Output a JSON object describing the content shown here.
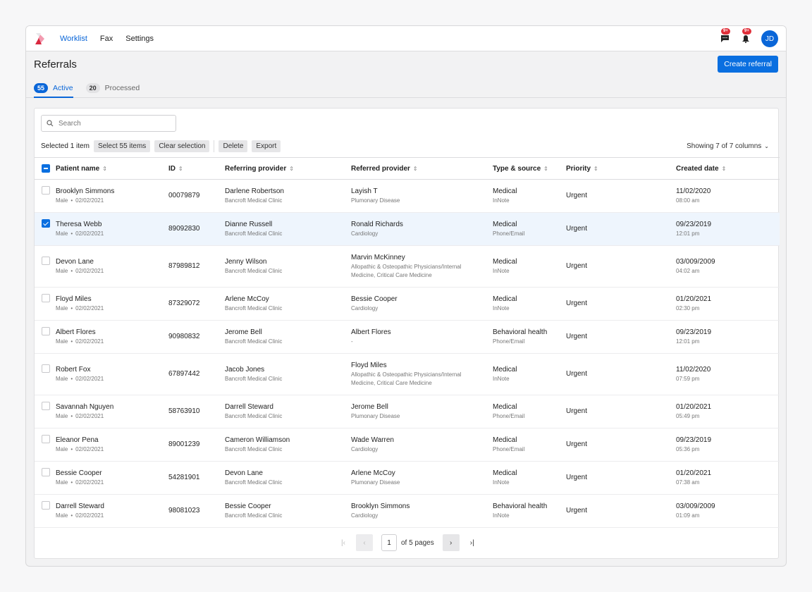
{
  "nav": {
    "items": [
      {
        "label": "Worklist",
        "active": true
      },
      {
        "label": "Fax",
        "active": false
      },
      {
        "label": "Settings",
        "active": false
      }
    ],
    "messages_badge": "9+",
    "notifications_badge": "9+",
    "avatar_initials": "JD"
  },
  "page": {
    "title": "Referrals",
    "create_button": "Create referral",
    "tabs": [
      {
        "count": "55",
        "label": "Active",
        "active": true
      },
      {
        "count": "20",
        "label": "Processed",
        "active": false
      }
    ]
  },
  "toolbar": {
    "search_placeholder": "Search",
    "selected_text": "Selected 1 item",
    "select_all": "Select 55 items",
    "clear_selection": "Clear selection",
    "delete": "Delete",
    "export": "Export",
    "columns_toggle": "Showing 7 of 7 columns"
  },
  "table": {
    "columns": [
      "Patient name",
      "ID",
      "Referring provider",
      "Referred provider",
      "Type & source",
      "Priority",
      "Created date"
    ],
    "rows": [
      {
        "checked": false,
        "patient": "Brooklyn Simmons",
        "sex": "Male",
        "dob": "02/02/2021",
        "id": "00079879",
        "referring": "Darlene Robertson",
        "referring_org": "Bancroft Medical Clinic",
        "referred": "Layish T",
        "specialty": "Plumonary Disease",
        "type": "Medical",
        "source": "InNote",
        "priority": "Urgent",
        "date": "11/02/2020",
        "time": "08:00 am"
      },
      {
        "checked": true,
        "patient": "Theresa Webb",
        "sex": "Male",
        "dob": "02/02/2021",
        "id": "89092830",
        "referring": "Dianne Russell",
        "referring_org": "Bancroft Medical Clinic",
        "referred": "Ronald Richards",
        "specialty": "Cardiology",
        "type": "Medical",
        "source": "Phone/Email",
        "priority": "Urgent",
        "date": "09/23/2019",
        "time": "12:01 pm"
      },
      {
        "checked": false,
        "patient": "Devon Lane",
        "sex": "Male",
        "dob": "02/02/2021",
        "id": "87989812",
        "referring": "Jenny Wilson",
        "referring_org": "Bancroft Medical Clinic",
        "referred": "Marvin McKinney",
        "specialty": "Allopathic & Osteopathic Physicians/Internal Medicine, Critical Care Medicine",
        "type": "Medical",
        "source": "InNote",
        "priority": "Urgent",
        "date": "03/009/2009",
        "time": "04:02 am"
      },
      {
        "checked": false,
        "patient": "Floyd Miles",
        "sex": "Male",
        "dob": "02/02/2021",
        "id": "87329072",
        "referring": "Arlene McCoy",
        "referring_org": "Bancroft Medical Clinic",
        "referred": "Bessie Cooper",
        "specialty": "Cardiology",
        "type": "Medical",
        "source": "InNote",
        "priority": "Urgent",
        "date": "01/20/2021",
        "time": "02:30 pm"
      },
      {
        "checked": false,
        "patient": "Albert Flores",
        "sex": "Male",
        "dob": "02/02/2021",
        "id": "90980832",
        "referring": "Jerome Bell",
        "referring_org": "Bancroft Medical Clinic",
        "referred": "Albert Flores",
        "specialty": "-",
        "type": "Behavioral health",
        "source": "Phone/Email",
        "priority": "Urgent",
        "date": "09/23/2019",
        "time": "12:01 pm"
      },
      {
        "checked": false,
        "patient": "Robert Fox",
        "sex": "Male",
        "dob": "02/02/2021",
        "id": "67897442",
        "referring": "Jacob Jones",
        "referring_org": "Bancroft Medical Clinic",
        "referred": "Floyd Miles",
        "specialty": "Allopathic & Osteopathic Physicians/Internal Medicine, Critical Care Medicine",
        "type": "Medical",
        "source": "InNote",
        "priority": "Urgent",
        "date": "11/02/2020",
        "time": "07:59 pm"
      },
      {
        "checked": false,
        "patient": "Savannah Nguyen",
        "sex": "Male",
        "dob": "02/02/2021",
        "id": "58763910",
        "referring": "Darrell Steward",
        "referring_org": "Bancroft Medical Clinic",
        "referred": "Jerome Bell",
        "specialty": "Plumonary Disease",
        "type": "Medical",
        "source": "Phone/Email",
        "priority": "Urgent",
        "date": "01/20/2021",
        "time": "05:49 pm"
      },
      {
        "checked": false,
        "patient": "Eleanor Pena",
        "sex": "Male",
        "dob": "02/02/2021",
        "id": "89001239",
        "referring": "Cameron Williamson",
        "referring_org": "Bancroft Medical Clinic",
        "referred": "Wade Warren",
        "specialty": "Cardiology",
        "type": "Medical",
        "source": "Phone/Email",
        "priority": "Urgent",
        "date": "09/23/2019",
        "time": "05:36 pm"
      },
      {
        "checked": false,
        "patient": "Bessie Cooper",
        "sex": "Male",
        "dob": "02/02/2021",
        "id": "54281901",
        "referring": "Devon Lane",
        "referring_org": "Bancroft Medical Clinic",
        "referred": "Arlene McCoy",
        "specialty": "Plumonary Disease",
        "type": "Medical",
        "source": "InNote",
        "priority": "Urgent",
        "date": "01/20/2021",
        "time": "07:38 am"
      },
      {
        "checked": false,
        "patient": "Darrell Steward",
        "sex": "Male",
        "dob": "02/02/2021",
        "id": "98081023",
        "referring": "Bessie Cooper",
        "referring_org": "Bancroft Medical Clinic",
        "referred": "Brooklyn Simmons",
        "specialty": "Cardiology",
        "type": "Behavioral health",
        "source": "InNote",
        "priority": "Urgent",
        "date": "03/009/2009",
        "time": "01:09 am"
      }
    ]
  },
  "pagination": {
    "current_page": "1",
    "of_pages_label": "of 5 pages"
  },
  "colors": {
    "accent": "#0a66d8",
    "badge": "#e0303a",
    "selected_row": "#eef5fd"
  }
}
